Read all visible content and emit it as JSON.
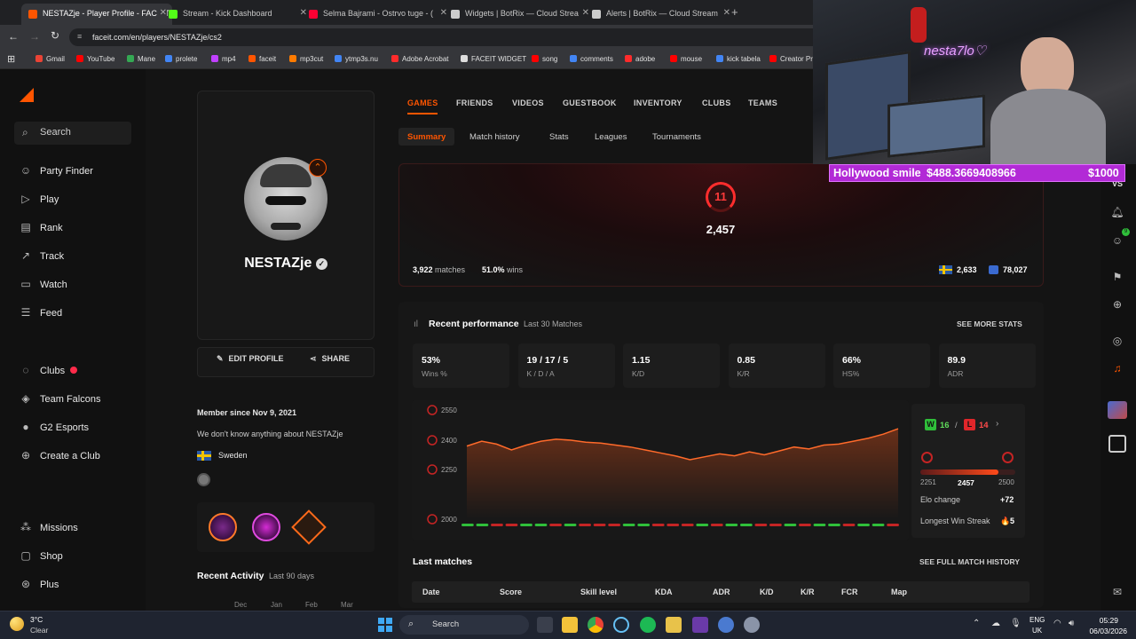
{
  "browser": {
    "tabs": [
      {
        "title": "NESTAZje - Player Profile - FACEIT",
        "color": "#ff5500",
        "active": true
      },
      {
        "title": "Stream - Kick Dashboard",
        "color": "#53fc18",
        "active": false
      },
      {
        "title": "Selma Bajrami - Ostrvo tuge - (",
        "color": "#ff0033",
        "active": false
      },
      {
        "title": "Widgets | BotRix — Cloud Strea",
        "color": "#cccccc",
        "active": false
      },
      {
        "title": "Alerts | BotRix — Cloud Stream",
        "color": "#cccccc",
        "active": false
      }
    ],
    "url": "faceit.com/en/players/NESTAZje/cs2",
    "bookmarks": [
      {
        "label": "Gmail",
        "color": "#ea4335"
      },
      {
        "label": "YouTube",
        "color": "#ff0000"
      },
      {
        "label": "Mane",
        "color": "#34a853"
      },
      {
        "label": "prolete",
        "color": "#4285f4"
      },
      {
        "label": "mp4",
        "color": "#c040ff"
      },
      {
        "label": "faceit",
        "color": "#ff5500"
      },
      {
        "label": "mp3cut",
        "color": "#ff7b00"
      },
      {
        "label": "ytmp3s.nu",
        "color": "#4285f4"
      },
      {
        "label": "Adobe Acrobat",
        "color": "#ff2b2b"
      },
      {
        "label": "FACEIT WIDGET",
        "color": "#dddddd"
      },
      {
        "label": "song",
        "color": "#ff0000"
      },
      {
        "label": "comments",
        "color": "#4285f4"
      },
      {
        "label": "adobe",
        "color": "#ff2b2b"
      },
      {
        "label": "mouse",
        "color": "#ff0000"
      },
      {
        "label": "kick tabela",
        "color": "#4285f4"
      },
      {
        "label": "Creator Pr",
        "color": "#ff0000"
      }
    ]
  },
  "nav": {
    "search": "Search",
    "items": [
      {
        "label": "Party Finder",
        "icon": "users-icon",
        "glyph": "☺"
      },
      {
        "label": "Play",
        "icon": "play-icon",
        "glyph": "▷"
      },
      {
        "label": "Rank",
        "icon": "rank-icon",
        "glyph": "▤"
      },
      {
        "label": "Track",
        "icon": "track-icon",
        "glyph": "↗"
      },
      {
        "label": "Watch",
        "icon": "watch-icon",
        "glyph": "▭"
      },
      {
        "label": "Feed",
        "icon": "feed-icon",
        "glyph": "☰"
      }
    ],
    "clubs": [
      {
        "label": "Clubs",
        "icon": "clubs-icon",
        "glyph": "◌"
      },
      {
        "label": "Team Falcons",
        "icon": "falcons-icon",
        "glyph": "◈"
      },
      {
        "label": "G2 Esports",
        "icon": "g2-icon",
        "glyph": "●"
      },
      {
        "label": "Create a Club",
        "icon": "plus-circle-icon",
        "glyph": "⊕"
      }
    ],
    "bottom": [
      {
        "label": "Missions",
        "icon": "missions-icon",
        "glyph": "⁂"
      },
      {
        "label": "Shop",
        "icon": "shop-icon",
        "glyph": "▢"
      },
      {
        "label": "Plus",
        "icon": "plus-icon",
        "glyph": "⊛"
      }
    ]
  },
  "profile": {
    "name": "NESTAZje",
    "edit": "EDIT PROFILE",
    "share": "SHARE",
    "member_since": "Member since Nov 9, 2021",
    "about": "We don't know anything about NESTAZje",
    "country": "Sweden",
    "recent_activity": "Recent Activity",
    "recent_activity_sub": "Last 90 days",
    "months": [
      "Dec",
      "Jan",
      "Feb",
      "Mar"
    ]
  },
  "tabs": {
    "top": [
      "GAMES",
      "FRIENDS",
      "VIDEOS",
      "GUESTBOOK",
      "INVENTORY",
      "CLUBS",
      "TEAMS"
    ],
    "sub": [
      "Summary",
      "Match history",
      "Stats",
      "Leagues",
      "Tournaments"
    ]
  },
  "elo": {
    "level": "11",
    "value": "2,457",
    "matches": "3,922",
    "matches_label": "matches",
    "winrate": "51.0%",
    "wins_label": "wins",
    "country_rank": "2,633",
    "region_rank": "78,027",
    "accent": "#ff2d2d"
  },
  "performance": {
    "title": "Recent performance",
    "subtitle": "Last 30 Matches",
    "see_more": "SEE MORE STATS",
    "stats": [
      {
        "value": "53%",
        "label": "Wins %"
      },
      {
        "value": "19 / 17 / 5",
        "label": "K / D / A"
      },
      {
        "value": "1.15",
        "label": "K/D"
      },
      {
        "value": "0.85",
        "label": "K/R"
      },
      {
        "value": "66%",
        "label": "HS%"
      },
      {
        "value": "89.9",
        "label": "ADR"
      }
    ],
    "wins": "16",
    "losses": "14",
    "range_min": "2251",
    "range_current": "2457",
    "range_max": "2500",
    "elo_change_label": "Elo change",
    "elo_change": "+72",
    "streak_label": "Longest Win Streak",
    "streak": "5"
  },
  "chart_data": {
    "type": "line",
    "title": "",
    "ylim": [
      2000,
      2550
    ],
    "yticks": [
      2550,
      2400,
      2250,
      2000
    ],
    "values": [
      2370,
      2395,
      2380,
      2350,
      2375,
      2395,
      2405,
      2400,
      2390,
      2385,
      2375,
      2365,
      2350,
      2335,
      2320,
      2300,
      2315,
      2330,
      2320,
      2340,
      2325,
      2345,
      2365,
      2355,
      2375,
      2380,
      2395,
      2410,
      2430,
      2457
    ],
    "results": [
      "W",
      "W",
      "L",
      "L",
      "W",
      "W",
      "L",
      "W",
      "L",
      "L",
      "L",
      "W",
      "W",
      "L",
      "L",
      "L",
      "W",
      "L",
      "W",
      "W",
      "L",
      "L",
      "W",
      "L",
      "W",
      "W",
      "L",
      "W",
      "W",
      "L"
    ]
  },
  "last_matches": {
    "title": "Last matches",
    "see_full": "SEE FULL MATCH HISTORY",
    "columns": [
      "Date",
      "Score",
      "Skill level",
      "KDA",
      "ADR",
      "K/D",
      "K/R",
      "FCR",
      "Map"
    ]
  },
  "stream": {
    "donation_name": "Hollywood smile",
    "donation_amount": "$488.3669408966",
    "goal": "$1000",
    "neon_sign": "nesta7lo♡"
  },
  "taskbar": {
    "weather_temp": "3°C",
    "weather_desc": "Clear",
    "search": "Search",
    "lang": "ENG",
    "region": "UK",
    "time": "05:29",
    "date": "06/03/2026"
  }
}
